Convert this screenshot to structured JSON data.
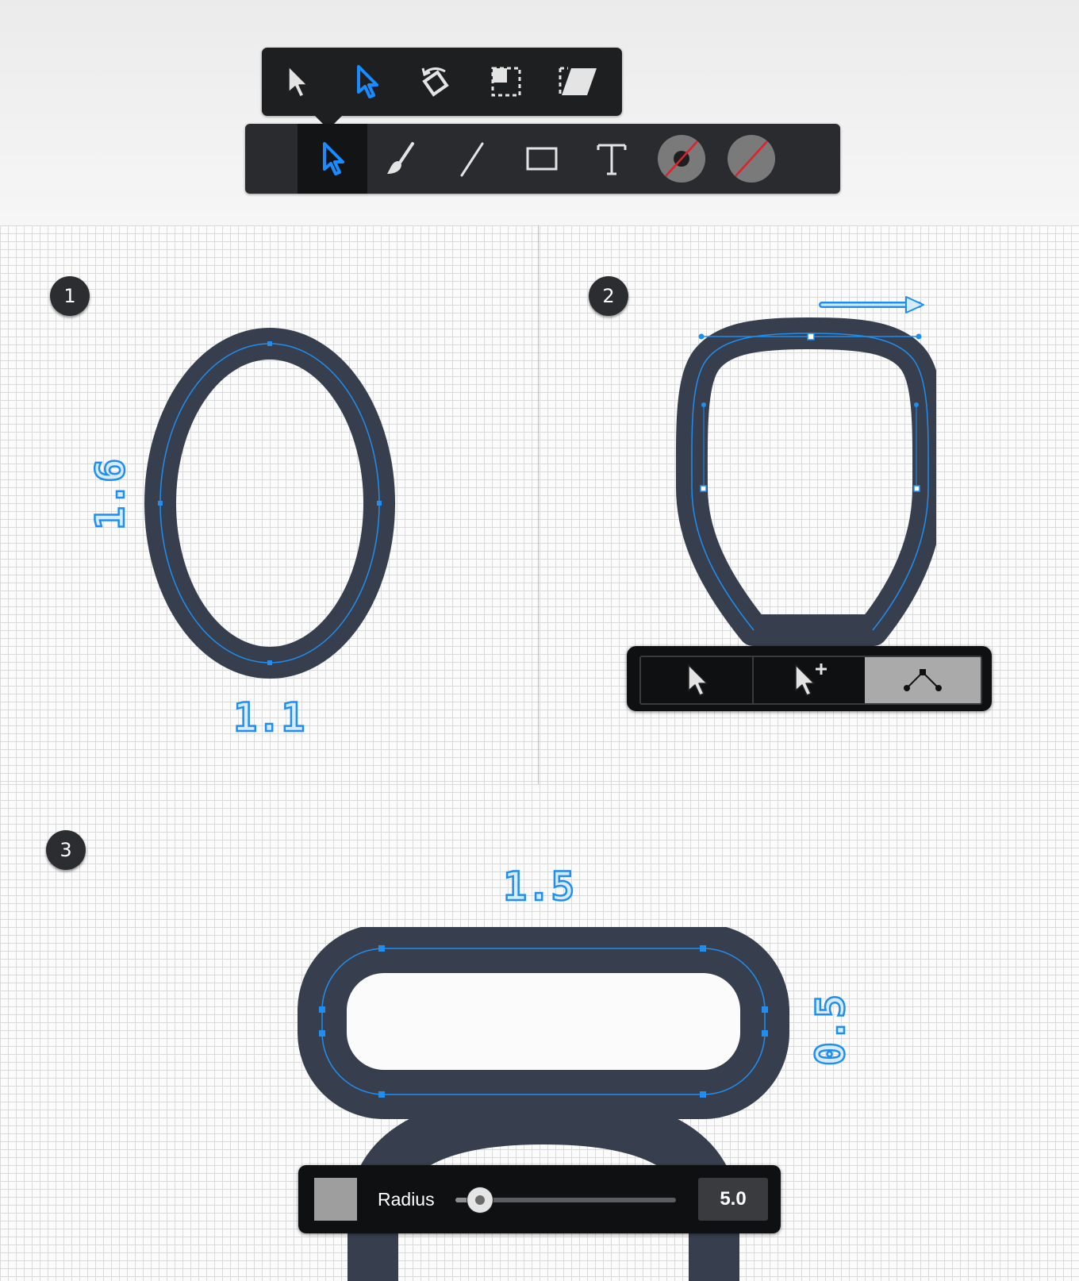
{
  "toolbar_upper": {
    "tools": [
      {
        "icon": "move-arrow-icon",
        "active": false
      },
      {
        "icon": "node-arrow-icon",
        "active": true
      },
      {
        "icon": "rotate-icon",
        "active": false
      },
      {
        "icon": "scale-icon",
        "active": false
      },
      {
        "icon": "skew-icon",
        "active": false
      }
    ]
  },
  "toolbar_lower": {
    "tools": [
      {
        "icon": "move-tool-icon",
        "active": true
      },
      {
        "icon": "brush-icon",
        "active": false
      },
      {
        "icon": "line-icon",
        "active": false
      },
      {
        "icon": "rectangle-icon",
        "active": false
      },
      {
        "icon": "text-tool-icon",
        "active": false
      },
      {
        "icon": "stroke-color-icon",
        "active": false
      },
      {
        "icon": "fill-color-icon",
        "active": false
      }
    ],
    "colors": {
      "stroke": "#7a7a7a",
      "fill": "#7a7a7a",
      "none_slash": "#e0202a"
    }
  },
  "steps": {
    "one": "1",
    "two": "2",
    "three": "3"
  },
  "measurements": {
    "ellipse_height": "1.6",
    "ellipse_width": "1.1",
    "rect_width": "1.5",
    "rect_height": "0.5"
  },
  "path_toolbar": {
    "tools": [
      {
        "icon": "select-node-icon",
        "active": false
      },
      {
        "icon": "add-node-icon",
        "active": false
      },
      {
        "icon": "corner-node-icon",
        "active": true
      }
    ]
  },
  "radius_bar": {
    "label": "Radius",
    "value": "5.0",
    "slider_fraction": 0.11,
    "swatch_color": "#9e9e9e"
  },
  "colors": {
    "shape_stroke": "#373f4e",
    "path_blue": "#1f8ef0",
    "accent_blue": "#1a8cff"
  }
}
